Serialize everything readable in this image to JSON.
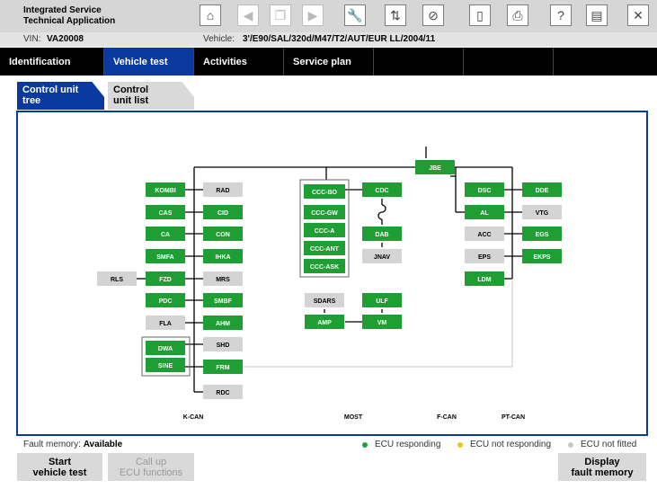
{
  "app": {
    "title": "Integrated Service\nTechnical Application"
  },
  "vehicle": {
    "vin_label": "VIN:",
    "vin": "VA20008",
    "vehicle_label": "Vehicle:",
    "vehicle_value": "3'/E90/SAL/320d/M47/T2/AUT/EUR LL/2004/11"
  },
  "toolbar": {
    "icons": [
      "home-icon",
      "back-icon",
      "copy-icon",
      "forward-icon",
      "wrench-icon",
      "transfer-icon",
      "no-connection-icon",
      "battery-icon",
      "print-icon",
      "help-icon",
      "minimize-icon",
      "close-icon"
    ]
  },
  "nav": {
    "tabs": [
      "Identification",
      "Vehicle test",
      "Activities",
      "Service plan"
    ]
  },
  "subtabs": {
    "tree": "Control unit\ntree",
    "list": "Control\nunit list"
  },
  "diagram": {
    "bus_labels": {
      "kcan": "K-CAN",
      "most": "MOST",
      "fcan": "F-CAN",
      "ptcan": "PT-CAN"
    },
    "ecus": [
      {
        "label": "JBE",
        "status": "responding"
      },
      {
        "label": "KOMBI",
        "status": "responding"
      },
      {
        "label": "CAS",
        "status": "responding"
      },
      {
        "label": "CA",
        "status": "responding"
      },
      {
        "label": "SMFA",
        "status": "responding"
      },
      {
        "label": "FZD",
        "status": "responding"
      },
      {
        "label": "PDC",
        "status": "responding"
      },
      {
        "label": "FLA",
        "status": "not_fitted"
      },
      {
        "label": "DWA",
        "status": "responding"
      },
      {
        "label": "SINE",
        "status": "responding"
      },
      {
        "label": "RLS",
        "status": "not_fitted"
      },
      {
        "label": "RAD",
        "status": "not_fitted"
      },
      {
        "label": "CID",
        "status": "responding"
      },
      {
        "label": "CON",
        "status": "responding"
      },
      {
        "label": "IHKA",
        "status": "responding"
      },
      {
        "label": "MRS",
        "status": "not_fitted"
      },
      {
        "label": "SMBF",
        "status": "responding"
      },
      {
        "label": "AHM",
        "status": "responding"
      },
      {
        "label": "SHD",
        "status": "not_fitted"
      },
      {
        "label": "FRM",
        "status": "responding"
      },
      {
        "label": "RDC",
        "status": "not_fitted"
      },
      {
        "label": "CCC-BO",
        "status": "responding"
      },
      {
        "label": "CCC-GW",
        "status": "responding"
      },
      {
        "label": "CCC-A",
        "status": "responding"
      },
      {
        "label": "CCC-ANT",
        "status": "responding"
      },
      {
        "label": "CCC-ASK",
        "status": "responding"
      },
      {
        "label": "SDARS",
        "status": "not_fitted"
      },
      {
        "label": "AMP",
        "status": "responding"
      },
      {
        "label": "CDC",
        "status": "responding"
      },
      {
        "label": "DAB",
        "status": "responding"
      },
      {
        "label": "JNAV",
        "status": "not_fitted"
      },
      {
        "label": "ULF",
        "status": "responding"
      },
      {
        "label": "VM",
        "status": "responding"
      },
      {
        "label": "DSC",
        "status": "responding"
      },
      {
        "label": "AL",
        "status": "responding"
      },
      {
        "label": "ACC",
        "status": "not_fitted"
      },
      {
        "label": "EPS",
        "status": "not_fitted"
      },
      {
        "label": "LDM",
        "status": "responding"
      },
      {
        "label": "DDE",
        "status": "responding"
      },
      {
        "label": "VTG",
        "status": "not_fitted"
      },
      {
        "label": "EGS",
        "status": "responding"
      },
      {
        "label": "EKPS",
        "status": "responding"
      }
    ]
  },
  "status": {
    "fault_label": "Fault memory:",
    "fault_value": "Available"
  },
  "legend": [
    {
      "label": "ECU responding",
      "color": "#22a33a"
    },
    {
      "label": "ECU not responding",
      "color": "#f0c419"
    },
    {
      "label": "ECU not fitted",
      "color": "#c8c8c8"
    }
  ],
  "buttons": {
    "start": "Start\nvehicle test",
    "callup": "Call up\nECU functions",
    "display": "Display\nfault memory"
  },
  "colors": {
    "accent": "#0a3aa0",
    "responding": "#1f9e33",
    "not_fitted": "#d4d4d4"
  }
}
